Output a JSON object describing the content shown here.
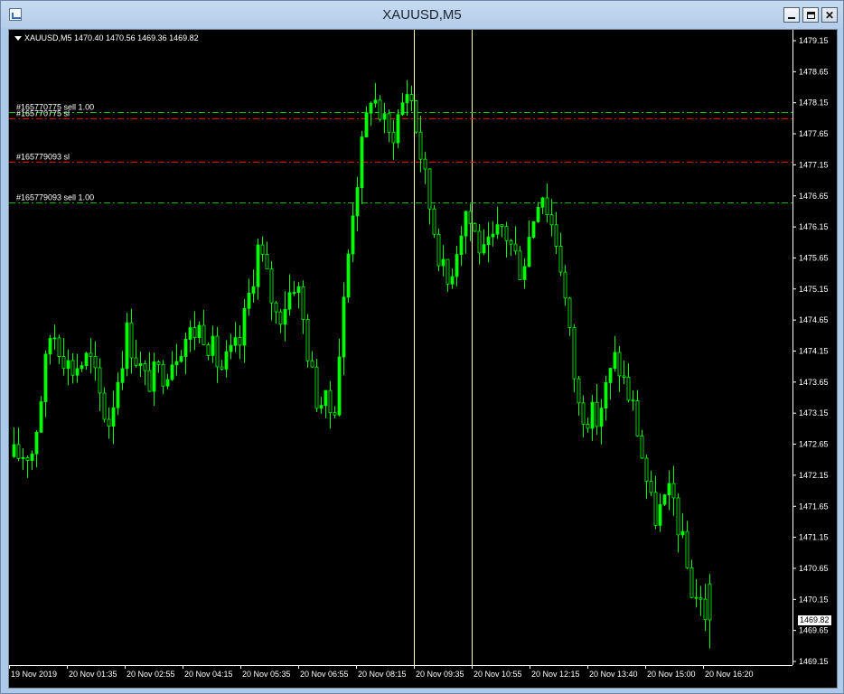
{
  "window": {
    "title": "XAUUSD,M5",
    "buttons": [
      "minimize",
      "maximize",
      "close"
    ]
  },
  "chart_info": {
    "text": "XAUUSD,M5  1470.40 1470.56 1469.36 1469.82"
  },
  "colors": {
    "background": "#000000",
    "candles": "#00ff00",
    "sl_line": "#ff0000",
    "sell_line": "#00c000",
    "vline": "#ffffaa",
    "axis_text": "#ffffff",
    "title_bar": "#b9d1ea"
  },
  "chart_data": {
    "type": "candlestick",
    "symbol": "XAUUSD",
    "timeframe": "M5",
    "ylim": [
      1469.15,
      1479.15
    ],
    "y_ticks": [
      "1479.15",
      "1478.65",
      "1478.15",
      "1477.65",
      "1477.15",
      "1476.65",
      "1476.15",
      "1475.65",
      "1475.15",
      "1474.65",
      "1474.15",
      "1473.65",
      "1473.15",
      "1472.65",
      "1472.15",
      "1471.65",
      "1471.15",
      "1470.65",
      "1470.15",
      "1469.65",
      "1469.15"
    ],
    "x_ticks": [
      "19 Nov 2019",
      "20 Nov 01:35",
      "20 Nov 02:55",
      "20 Nov 04:15",
      "20 Nov 05:35",
      "20 Nov 06:55",
      "20 Nov 08:15",
      "20 Nov 09:35",
      "20 Nov 10:55",
      "20 Nov 12:15",
      "20 Nov 13:40",
      "20 Nov 15:00",
      "20 Nov 16:20"
    ],
    "current_price": "1469.82",
    "last_bar": {
      "open": 1470.4,
      "high": 1470.56,
      "low": 1469.36,
      "close": 1469.82
    },
    "close_path": [
      [
        "19 Nov 2019",
        1472.45
      ],
      [
        "20 Nov 01:35",
        1472.55
      ],
      [
        "",
        1474.55
      ],
      [
        "",
        1473.85
      ],
      [
        "",
        1474.05
      ],
      [
        "20 Nov 02:55",
        1472.95
      ],
      [
        "",
        1474.45
      ],
      [
        "",
        1473.65
      ],
      [
        "20 Nov 04:15",
        1473.85
      ],
      [
        "",
        1474.35
      ],
      [
        "20 Nov 05:35",
        1474.55
      ],
      [
        "",
        1473.85
      ],
      [
        "",
        1474.25
      ],
      [
        "20 Nov 06:55",
        1475.85
      ],
      [
        "",
        1474.65
      ],
      [
        "20 Nov 08:15",
        1475.35
      ],
      [
        "",
        1473.45
      ],
      [
        "",
        1473.15
      ],
      [
        "",
        1476.45
      ],
      [
        "20 Nov 09:35",
        1478.35
      ],
      [
        "",
        1477.55
      ],
      [
        "",
        1478.45
      ],
      [
        "",
        1476.65
      ],
      [
        "20 Nov 10:55",
        1475.15
      ],
      [
        "",
        1476.45
      ],
      [
        "",
        1475.65
      ],
      [
        "20 Nov 12:15",
        1476.15
      ],
      [
        "",
        1475.45
      ],
      [
        "",
        1476.85
      ],
      [
        "",
        1475.75
      ],
      [
        "20 Nov 13:40",
        1473.25
      ],
      [
        "",
        1473.05
      ],
      [
        "",
        1474.05
      ],
      [
        "",
        1473.15
      ],
      [
        "20 Nov 15:00",
        1471.45
      ],
      [
        "",
        1471.85
      ],
      [
        "",
        1470.35
      ],
      [
        "20 Nov 16:20",
        1469.82
      ]
    ],
    "order_lines": [
      {
        "label": "#165770775 sell 1.00",
        "price": 1478.0,
        "kind": "sell"
      },
      {
        "label": "#165770775 sl",
        "price": 1477.9,
        "kind": "sl"
      },
      {
        "label": "#165779093 sl",
        "price": 1477.2,
        "kind": "sl"
      },
      {
        "label": "#165779093 sell 1.00",
        "price": 1476.55,
        "kind": "sell"
      }
    ],
    "vertical_lines": [
      "20 Nov 09:35",
      "20 Nov 10:55"
    ],
    "grid": false
  }
}
